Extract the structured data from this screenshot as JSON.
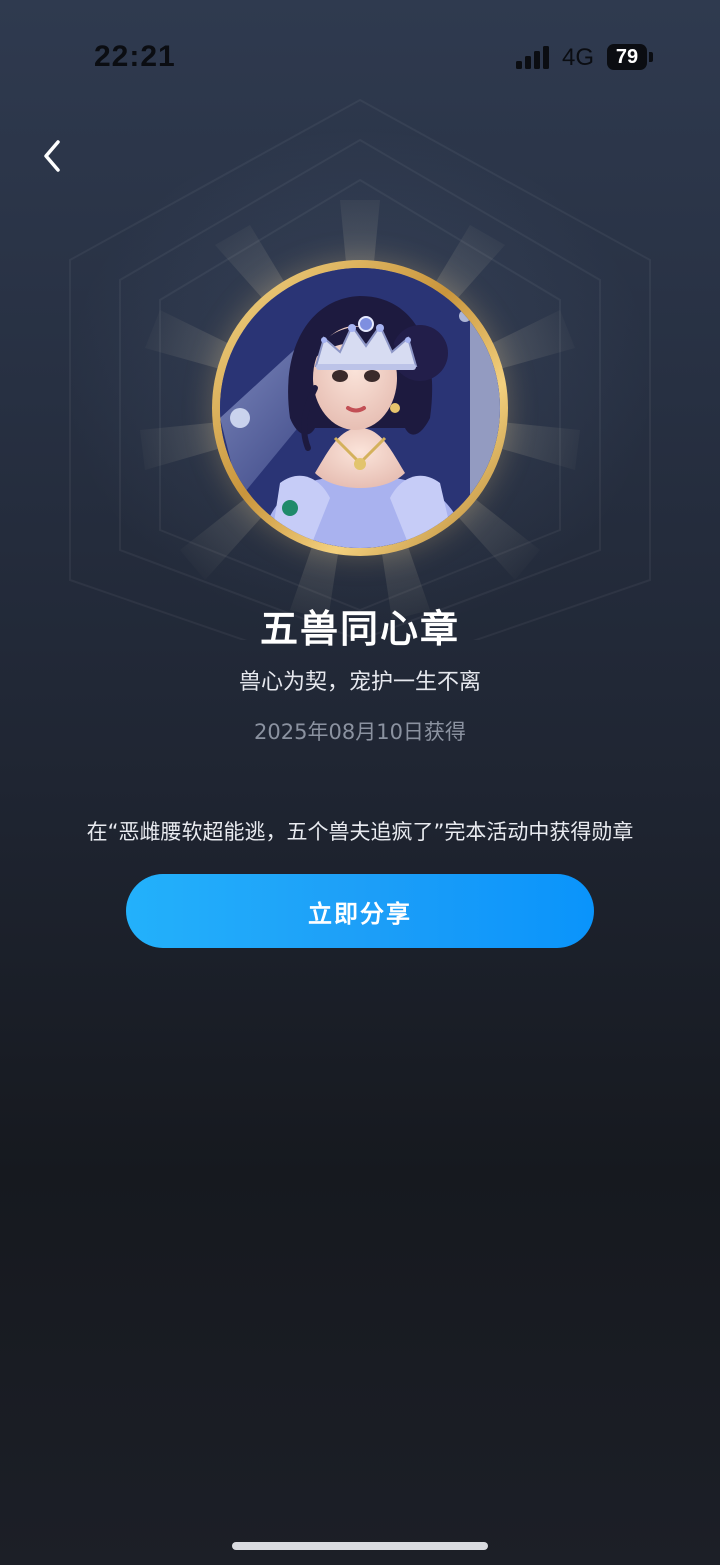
{
  "status_bar": {
    "time": "22:21",
    "network": "4G",
    "battery": "79",
    "icons": [
      "signal-icon",
      "battery-icon"
    ]
  },
  "nav": {
    "back_icon": "chevron-left-icon"
  },
  "badge": {
    "title": "五兽同心章",
    "slogan": "兽心为契，宠护一生不离",
    "earned_date": "2025年08月10日获得",
    "activity_desc": "在“恶雌腰软超能逃，五个兽夫追疯了”完本活动中获得勋章",
    "ring_color": "#d9ad5b"
  },
  "actions": {
    "share_label": "立即分享",
    "share_color": "#1aa3fa"
  }
}
